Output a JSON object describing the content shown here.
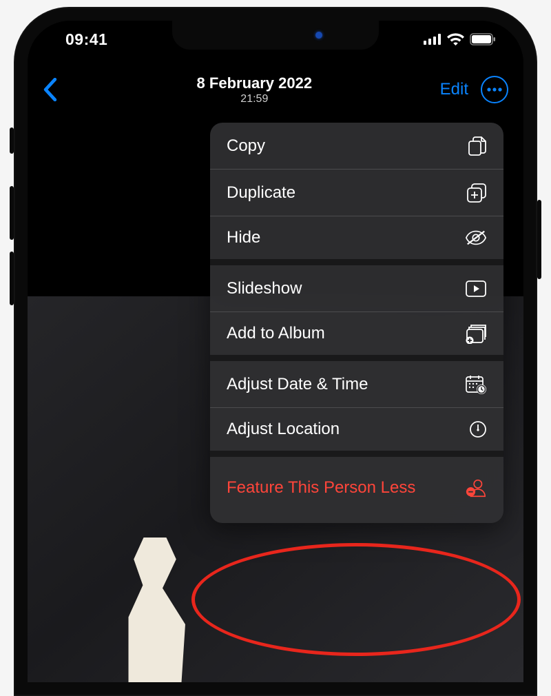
{
  "status": {
    "time": "09:41"
  },
  "nav": {
    "title": "8 February 2022",
    "subtitle": "21:59",
    "edit_label": "Edit"
  },
  "menu": {
    "items": [
      {
        "label": "Copy",
        "icon": "copy-icon"
      },
      {
        "label": "Duplicate",
        "icon": "duplicate-icon"
      },
      {
        "label": "Hide",
        "icon": "hide-icon"
      },
      {
        "label": "Slideshow",
        "icon": "slideshow-icon"
      },
      {
        "label": "Add to Album",
        "icon": "add-to-album-icon"
      },
      {
        "label": "Adjust Date & Time",
        "icon": "calendar-clock-icon"
      },
      {
        "label": "Adjust Location",
        "icon": "location-icon"
      },
      {
        "label": "Feature This Person Less",
        "icon": "person-minus-icon"
      }
    ]
  },
  "colors": {
    "accent": "#0a84ff",
    "destructive": "#ff453a"
  }
}
